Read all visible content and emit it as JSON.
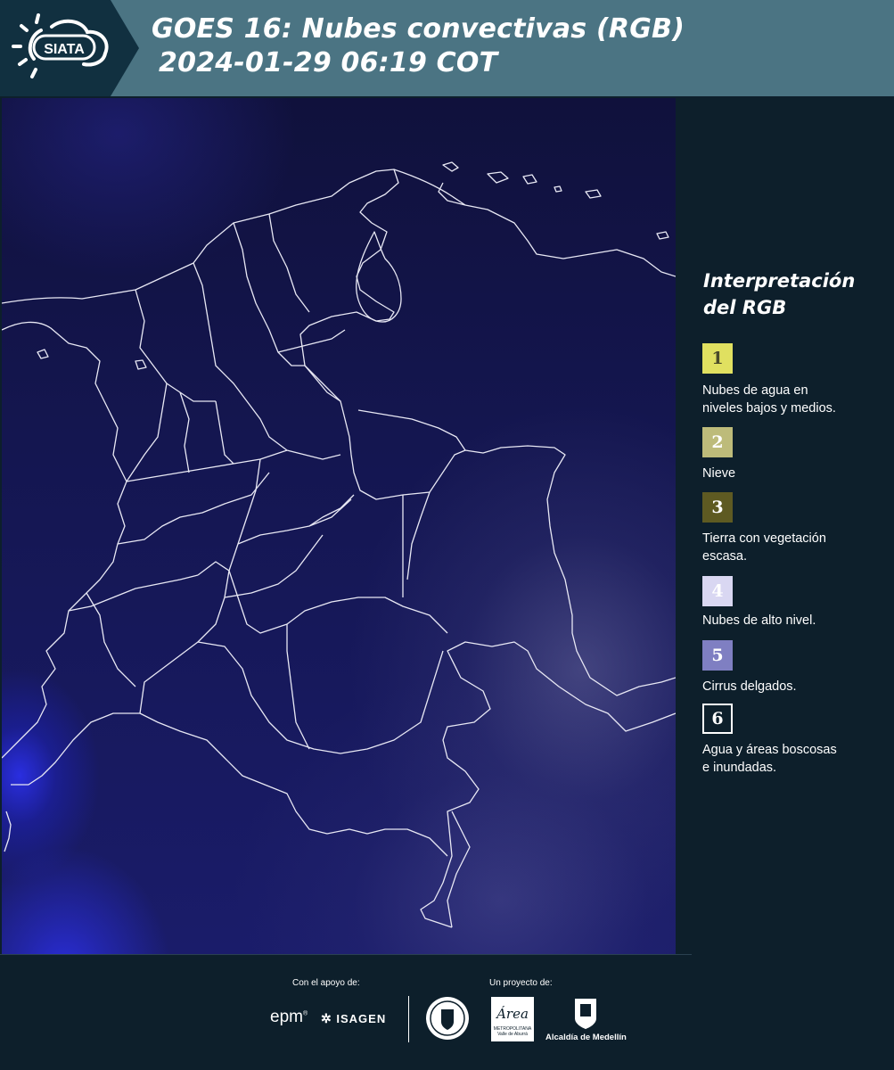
{
  "header": {
    "logo_text": "SIATA",
    "title_line1": "GOES 16: Nubes convectivas (RGB)",
    "title_line2": "2024-01-29 06:19 COT",
    "bg_color": "#4b7483"
  },
  "legend": {
    "title_line1": "Interpretación",
    "title_line2": "del RGB",
    "items": [
      {
        "number": "1",
        "label_line1": "Nubes de agua en",
        "label_line2": "niveles bajos y medios.",
        "color": "#e0e060",
        "text_color": "#4a4a2a"
      },
      {
        "number": "2",
        "label_line1": "Nieve",
        "label_line2": "",
        "color": "#bdbb7a",
        "text_color": "#ffffff"
      },
      {
        "number": "3",
        "label_line1": "Tierra con vegetación",
        "label_line2": "escasa.",
        "color": "#5e5a22",
        "text_color": "#ffffff"
      },
      {
        "number": "4",
        "label_line1": "Nubes de alto nivel.",
        "label_line2": "",
        "color": "#d9d7f2",
        "text_color": "#ffffff"
      },
      {
        "number": "5",
        "label_line1": "Cirrus delgados.",
        "label_line2": "",
        "color": "#7f7fc2",
        "text_color": "#ffffff"
      },
      {
        "number": "6",
        "label_line1": "Agua y áreas boscosas",
        "label_line2": "e inundadas.",
        "color": "#0d1f2b",
        "text_color": "#ffffff"
      }
    ]
  },
  "footer": {
    "support_label": "Con el apoyo de:",
    "project_label": "Un proyecto de:",
    "sponsor_epm": "epm",
    "sponsor_isagen": "ISAGEN",
    "area_logo_text": "Área",
    "area_subtitle": "METROPOLITANA",
    "area_subtitle2": "Valle de Aburrá",
    "alcaldia": "Alcaldía de Medellín"
  }
}
